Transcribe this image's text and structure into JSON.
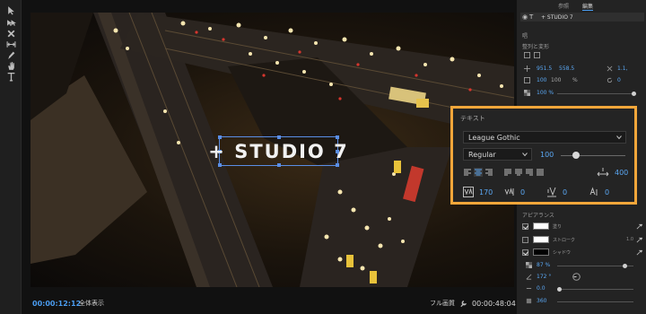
{
  "monitor": {
    "overlay_text": "+ STUDIO 7",
    "timecode_current": "00:00:12:12",
    "fit_label": "全体表示",
    "quality_label": "フル画質",
    "timecode_duration": "00:00:48:04"
  },
  "panel": {
    "tabs": [
      "参照",
      "編集"
    ],
    "layer_name": "+ STUDIO 7",
    "section_text_label": "唱",
    "section_align": "整列と変形",
    "position_x": "951.5",
    "position_y": "558.5",
    "scale_extra": "1.1,",
    "scale": "100",
    "scale_extra2": "100",
    "scale_unit": "%",
    "rotation": "0",
    "opacity": "100 %"
  },
  "text_props": {
    "title": "テキスト",
    "font": "League Gothic",
    "style": "Regular",
    "size": "100",
    "tracking": "400",
    "kerning": "170",
    "leading": "0",
    "baseline": "0",
    "tsume": "0"
  },
  "appearance": {
    "title": "アピアランス",
    "fill_label": "塗り",
    "stroke_label": "ストローク",
    "stroke_width": "1.0",
    "shadow_label": "シャドウ",
    "shadow_opacity": "87 %",
    "shadow_angle": "172 °",
    "shadow_distance": "0.0",
    "shadow_size": "360"
  },
  "colors": {
    "accent_blue": "#4a9cf0",
    "highlight_orange": "#f2a63a",
    "fill_color": "#ffffff",
    "stroke_color": "#ffffff",
    "shadow_color": "#000000"
  }
}
